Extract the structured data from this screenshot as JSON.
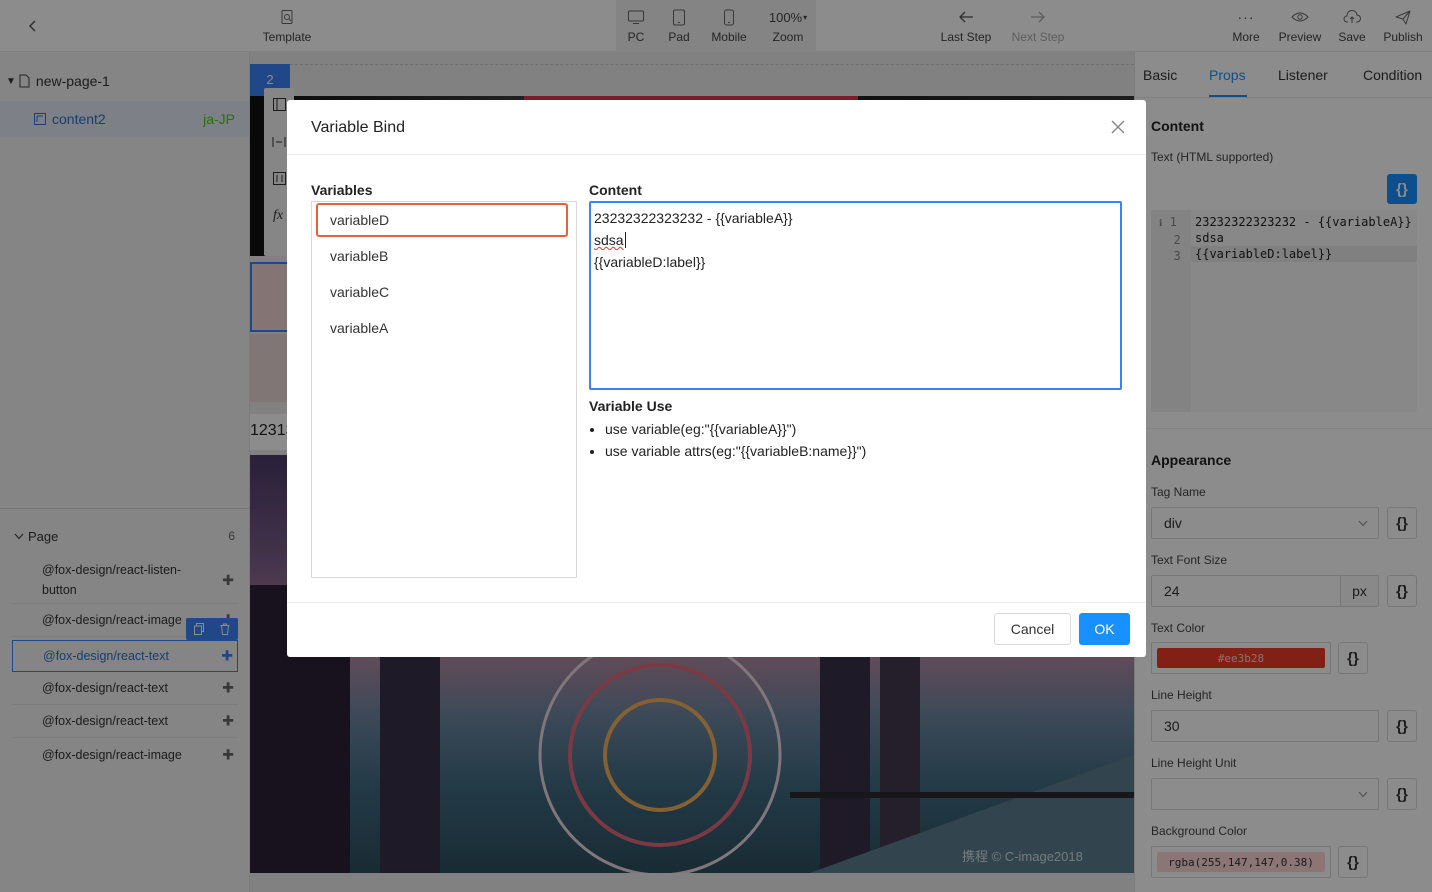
{
  "toolbar": {
    "template_label": "Template",
    "pc_label": "PC",
    "pad_label": "Pad",
    "mobile_label": "Mobile",
    "zoom_value": "100%",
    "zoom_label": "Zoom",
    "last_step_label": "Last Step",
    "next_step_label": "Next Step",
    "more_label": "More",
    "preview_label": "Preview",
    "save_label": "Save",
    "publish_label": "Publish"
  },
  "tree": {
    "page_name": "new-page-1",
    "content_name": "content2",
    "content_locale": "ja-JP"
  },
  "components": {
    "header": "Page",
    "count": "6",
    "items": [
      "@fox-design/react-listen-button",
      "@fox-design/react-image",
      "@fox-design/react-text",
      "@fox-design/react-text",
      "@fox-design/react-text",
      "@fox-design/react-image"
    ]
  },
  "canvas": {
    "badge": "2",
    "partial_text": "12313",
    "watermark": "携程 © C-image2018"
  },
  "right": {
    "tabs": [
      "Basic",
      "Props",
      "Listener",
      "Condition"
    ],
    "active_tab": "Props",
    "content_title": "Content",
    "text_label": "Text (HTML supported)",
    "code_lines": [
      "23232322323232 - {{variableA}}",
      "sdsa",
      "{{variableD:label}}"
    ],
    "appearance_title": "Appearance",
    "tag_name_label": "Tag Name",
    "tag_name_value": "div",
    "font_size_label": "Text Font Size",
    "font_size_value": "24",
    "font_size_unit": "px",
    "text_color_label": "Text Color",
    "text_color_value": "#ee3b28",
    "line_height_label": "Line Height",
    "line_height_value": "30",
    "line_height_unit_label": "Line Height Unit",
    "bg_color_label": "Background Color",
    "bg_color_value": "rgba(255,147,147,0.38)"
  },
  "modal": {
    "title": "Variable Bind",
    "variables_label": "Variables",
    "variables": [
      "variableD",
      "variableB",
      "variableC",
      "variableA"
    ],
    "selected_variable": "variableD",
    "content_label": "Content",
    "content_lines": [
      "23232322323232 - {{variableA}}",
      "sdsa",
      "{{variableD:label}}"
    ],
    "variable_use_title": "Variable Use",
    "variable_use_items": [
      "use variable(eg:\"{{variableA}}\")",
      "use variable attrs(eg:\"{{variableB:name}}\")"
    ],
    "cancel_label": "Cancel",
    "ok_label": "OK"
  },
  "colors": {
    "accent": "#1890ff",
    "selected_outline": "#e8603c",
    "text_color_swatch": "#ee3b28"
  }
}
